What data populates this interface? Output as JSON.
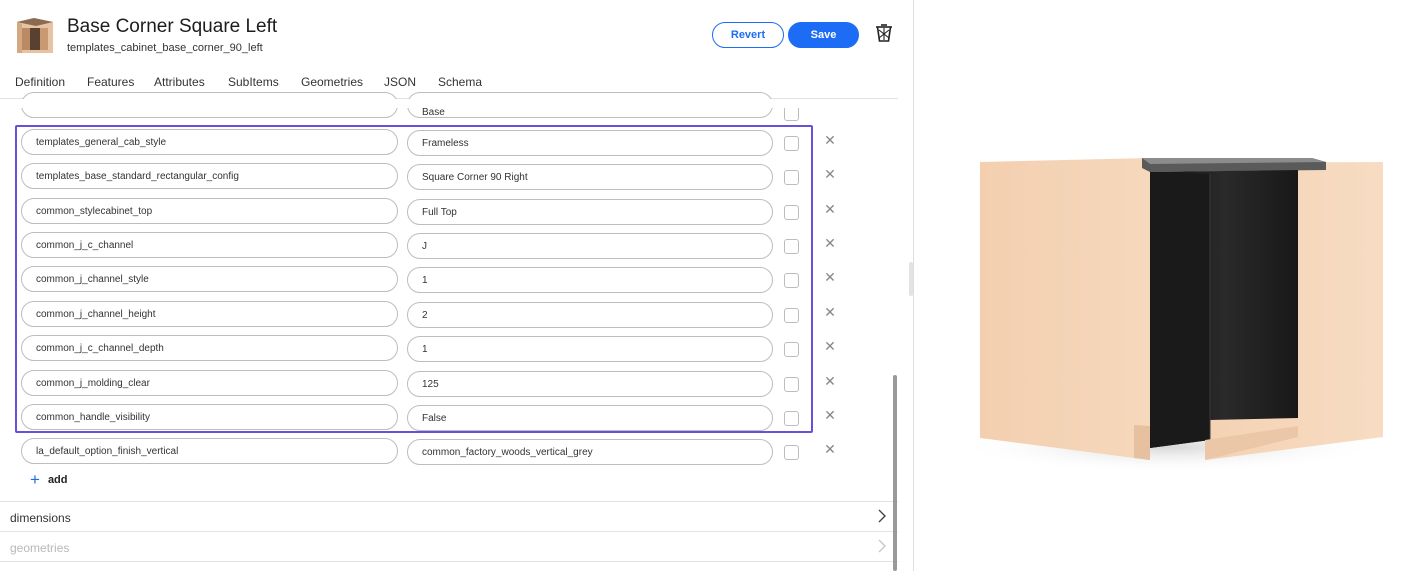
{
  "header": {
    "title": "Base Corner Square Left",
    "subtitle": "templates_cabinet_base_corner_90_left",
    "revert_label": "Revert",
    "save_label": "Save"
  },
  "tabs": [
    {
      "label": "Definition"
    },
    {
      "label": "Features"
    },
    {
      "label": "Attributes"
    },
    {
      "label": "SubItems"
    },
    {
      "label": "Geometries"
    },
    {
      "label": "JSON"
    },
    {
      "label": "Schema",
      "active": true
    }
  ],
  "rows": [
    {
      "key": "templates_general_cab_style",
      "value": "Frameless"
    },
    {
      "key": "templates_base_standard_rectangular_config",
      "value": "Square Corner 90 Right"
    },
    {
      "key": "common_stylecabinet_top",
      "value": "Full Top"
    },
    {
      "key": "common_j_c_channel",
      "value": "J"
    },
    {
      "key": "common_j_channel_style",
      "value": "1"
    },
    {
      "key": "common_j_channel_height",
      "value": "2"
    },
    {
      "key": "common_j_c_channel_depth",
      "value": "1"
    },
    {
      "key": "common_j_molding_clear",
      "value": "125"
    },
    {
      "key": "common_handle_visibility",
      "value": "False"
    },
    {
      "key": "la_default_option_finish_vertical",
      "value": "common_factory_woods_vertical_grey"
    }
  ],
  "partial_row": {
    "value": "Base"
  },
  "add_label": "add",
  "sections": [
    {
      "label": "dimensions",
      "disabled": false
    },
    {
      "label": "geometries",
      "disabled": true
    }
  ],
  "colors": {
    "accent": "#1d6cf5",
    "highlight": "#6a4fd8",
    "cabinet_side": "#f4d2b4",
    "cabinet_interior": "#1e1e1e",
    "cabinet_top": "#4a4a4a"
  },
  "icons": {
    "thumbnail": "cabinet-thumbnail-icon",
    "delete": "trash-icon",
    "remove_row": "close-icon",
    "expand": "chevron-right-icon",
    "add": "plus-icon"
  }
}
